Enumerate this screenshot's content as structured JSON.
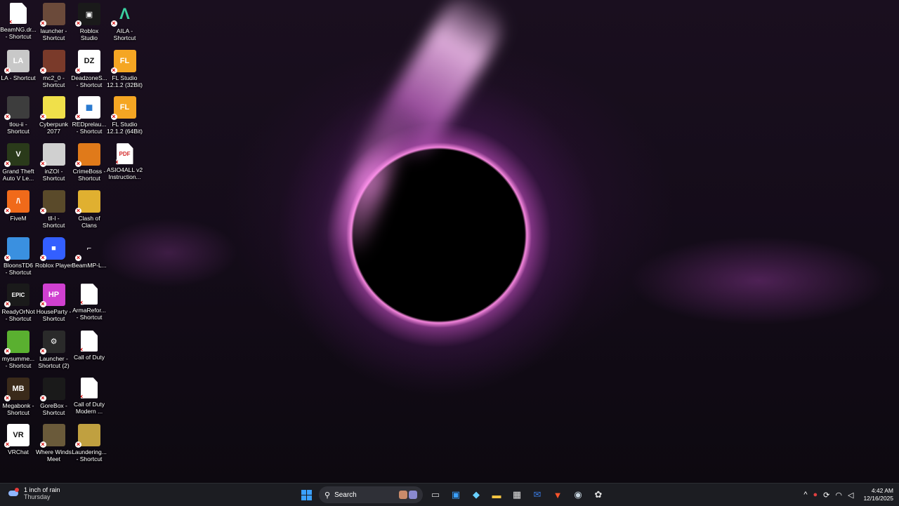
{
  "desktop": {
    "icons": [
      {
        "label": "BeamNG.dr...\n- Shortcut",
        "icon": "document-icon",
        "col": 0,
        "row": 0,
        "bg": "#ffffff",
        "text": ""
      },
      {
        "label": "launcher -\nShortcut",
        "icon": "game-portrait-icon",
        "col": 1,
        "row": 0,
        "bg": "#6b4a3a",
        "text": ""
      },
      {
        "label": "Roblox\nStudio",
        "icon": "roblox-studio-icon",
        "col": 2,
        "row": 0,
        "bg": "#1a1a1a",
        "text": "▣"
      },
      {
        "label": "AILA -\nShortcut",
        "icon": "aila-icon",
        "col": 3,
        "row": 0,
        "bg": "#0e2a22",
        "text": "Λ"
      },
      {
        "label": "LA - Shortcut",
        "icon": "la-icon",
        "col": 0,
        "row": 1,
        "bg": "#c8c8c8",
        "text": "LA"
      },
      {
        "label": "mc2_0 -\nShortcut",
        "icon": "mc2-icon",
        "col": 1,
        "row": 1,
        "bg": "#7a3a2a",
        "text": ""
      },
      {
        "label": "DeadzoneS...\n- Shortcut",
        "icon": "deadzone-icon",
        "col": 2,
        "row": 1,
        "bg": "#ffffff",
        "text": "DZ"
      },
      {
        "label": "FL Studio\n12.1.2 (32Bit)",
        "icon": "fl-studio-icon",
        "col": 3,
        "row": 1,
        "bg": "#f5a623",
        "text": "FL"
      },
      {
        "label": "tlou-ii -\nShortcut",
        "icon": "tlou-icon",
        "col": 0,
        "row": 2,
        "bg": "#3d3d3d",
        "text": ""
      },
      {
        "label": "Cyberpunk\n2077",
        "icon": "cyberpunk-icon",
        "col": 1,
        "row": 2,
        "bg": "#f0e04a",
        "text": ""
      },
      {
        "label": "REDprelau...\n- Shortcut",
        "icon": "redprelauncher-icon",
        "col": 2,
        "row": 2,
        "bg": "#ffffff",
        "text": "■"
      },
      {
        "label": "FL Studio\n12.1.2 (64Bit)",
        "icon": "fl-studio-icon",
        "col": 3,
        "row": 2,
        "bg": "#f5a623",
        "text": "FL"
      },
      {
        "label": "Grand Theft\nAuto V Le...",
        "icon": "gta-icon",
        "col": 0,
        "row": 3,
        "bg": "#2a3a1a",
        "text": "V"
      },
      {
        "label": "inZOI -\nShortcut",
        "icon": "inzoi-icon",
        "col": 1,
        "row": 3,
        "bg": "#d0d0d0",
        "text": ""
      },
      {
        "label": "CrimeBoss -\nShortcut",
        "icon": "crimeboss-icon",
        "col": 2,
        "row": 3,
        "bg": "#e07a1a",
        "text": ""
      },
      {
        "label": "ASIO4ALL v2\nInstruction...",
        "icon": "pdf-icon",
        "col": 3,
        "row": 3,
        "bg": "#ffffff",
        "text": "PDF"
      },
      {
        "label": "FiveM",
        "icon": "fivem-icon",
        "col": 0,
        "row": 4,
        "bg": "#f06a1a",
        "text": "/\\"
      },
      {
        "label": "tll-l -\nShortcut",
        "icon": "tll-icon",
        "col": 1,
        "row": 4,
        "bg": "#5a4a2a",
        "text": ""
      },
      {
        "label": "Clash of\nClans",
        "icon": "clash-of-clans-icon",
        "col": 2,
        "row": 4,
        "bg": "#e0b030",
        "text": ""
      },
      {
        "label": "BloonsTD6\n- Shortcut",
        "icon": "bloons-icon",
        "col": 0,
        "row": 5,
        "bg": "#3a90e0",
        "text": ""
      },
      {
        "label": "Roblox Player",
        "icon": "roblox-player-icon",
        "col": 1,
        "row": 5,
        "bg": "#335fff",
        "text": "■"
      },
      {
        "label": "BeamMP-L...",
        "icon": "beammp-icon",
        "col": 2,
        "row": 5,
        "bg": "transparent",
        "text": "⌐"
      },
      {
        "label": "ReadyOrNot\n- Shortcut",
        "icon": "epic-games-icon",
        "col": 0,
        "row": 6,
        "bg": "#1a1a1a",
        "text": "EPIC"
      },
      {
        "label": "HouseParty -\nShortcut",
        "icon": "houseparty-icon",
        "col": 1,
        "row": 6,
        "bg": "#d040d0",
        "text": "HP"
      },
      {
        "label": "ArmaRefor...\n- Shortcut",
        "icon": "document-icon",
        "col": 2,
        "row": 6,
        "bg": "#ffffff",
        "text": ""
      },
      {
        "label": "mysumme...\n- Shortcut",
        "icon": "mysummercar-icon",
        "col": 0,
        "row": 7,
        "bg": "#5ab030",
        "text": ""
      },
      {
        "label": "Launcher -\nShortcut (2)",
        "icon": "steam-icon",
        "col": 1,
        "row": 7,
        "bg": "#2a2a2a",
        "text": "⚙"
      },
      {
        "label": "Call of Duty",
        "icon": "document-icon",
        "col": 2,
        "row": 7,
        "bg": "#ffffff",
        "text": ""
      },
      {
        "label": "Megabonk -\nShortcut",
        "icon": "megabonk-icon",
        "col": 0,
        "row": 8,
        "bg": "#3a2a1a",
        "text": "MB"
      },
      {
        "label": "GoreBox -\nShortcut",
        "icon": "gorebox-icon",
        "col": 1,
        "row": 8,
        "bg": "#1a1a1a",
        "text": ""
      },
      {
        "label": "Call of Duty\nModern ...",
        "icon": "document-icon",
        "col": 2,
        "row": 8,
        "bg": "#ffffff",
        "text": ""
      },
      {
        "label": "VRChat",
        "icon": "vrchat-icon",
        "col": 0,
        "row": 9,
        "bg": "#ffffff",
        "text": "VR"
      },
      {
        "label": "Where Winds\nMeet",
        "icon": "where-winds-meet-icon",
        "col": 1,
        "row": 9,
        "bg": "#6a5a3a",
        "text": ""
      },
      {
        "label": "Laundering...\n- Shortcut",
        "icon": "laundering-icon",
        "col": 2,
        "row": 9,
        "bg": "#c0a040",
        "text": ""
      }
    ]
  },
  "taskbar": {
    "weather": {
      "line1": "1 inch of rain",
      "line2": "Thursday"
    },
    "search_label": "Search",
    "apps": [
      {
        "name": "task-view-icon",
        "symbol": "▭",
        "color": "#d0d0d0"
      },
      {
        "name": "widgets-icon",
        "symbol": "▣",
        "color": "#3aa0ff"
      },
      {
        "name": "copilot-icon",
        "symbol": "◆",
        "color": "#6ad0ff"
      },
      {
        "name": "file-explorer-icon",
        "symbol": "▬",
        "color": "#f5c542"
      },
      {
        "name": "microsoft-store-icon",
        "symbol": "▦",
        "color": "#e0e0e0"
      },
      {
        "name": "outlook-icon",
        "symbol": "✉",
        "color": "#3a7ae0"
      },
      {
        "name": "brave-browser-icon",
        "symbol": "▼",
        "color": "#fb542b"
      },
      {
        "name": "steam-icon",
        "symbol": "◉",
        "color": "#c7d5e0"
      },
      {
        "name": "chatgpt-icon",
        "symbol": "✿",
        "color": "#e0e0e0"
      }
    ],
    "tray": {
      "chevron": "^",
      "time": "4:42 AM",
      "date": "12/16/2025"
    }
  }
}
